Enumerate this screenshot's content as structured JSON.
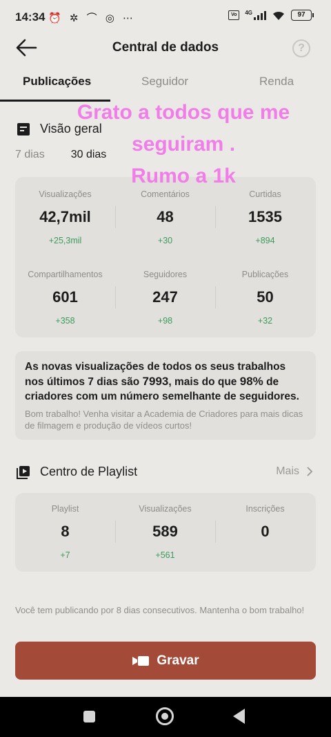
{
  "status_bar": {
    "time": "14:34",
    "left_icons": "⏰ ✲ ⌒ ◎ ⋯",
    "network": "4G",
    "battery": "97"
  },
  "header": {
    "title": "Central de dados",
    "help": "?"
  },
  "tabs": [
    {
      "label": "Publicações",
      "active": true
    },
    {
      "label": "Seguidor",
      "active": false
    },
    {
      "label": "Renda",
      "active": false
    }
  ],
  "overlay_caption": [
    "Grato a todos que me",
    "seguiram .",
    "Rumo a 1k"
  ],
  "overview": {
    "title": "Visão geral",
    "periods": [
      {
        "label": "7 dias",
        "active": false
      },
      {
        "label": "30 dias",
        "active": true
      }
    ],
    "stats": [
      {
        "label": "Visualizações",
        "value": "42,7mil",
        "delta": "+25,3mil"
      },
      {
        "label": "Comentários",
        "value": "48",
        "delta": "+30"
      },
      {
        "label": "Curtidas",
        "value": "1535",
        "delta": "+894"
      },
      {
        "label": "Compartilhamentos",
        "value": "601",
        "delta": "+358"
      },
      {
        "label": "Seguidores",
        "value": "247",
        "delta": "+98"
      },
      {
        "label": "Publicações",
        "value": "50",
        "delta": "+32"
      }
    ]
  },
  "insight": {
    "part1": "As novas visualizações de todos os seus trabalhos nos últimos 7 dias são ",
    "views": "7993",
    "part2": ", mais do que ",
    "percent": "98%",
    "part3": " de criadores com um número semelhante de seguidores.",
    "sub": "Bom trabalho! Venha visitar a Academia de Criadores para mais dicas de filmagem e produção de vídeos curtos!"
  },
  "playlist": {
    "title": "Centro de Playlist",
    "more": "Mais",
    "stats": [
      {
        "label": "Playlist",
        "value": "8",
        "delta": "+7"
      },
      {
        "label": "Visualizações",
        "value": "589",
        "delta": "+561"
      },
      {
        "label": "Inscrições",
        "value": "0",
        "delta": ""
      }
    ]
  },
  "footer_note": "Você tem publicando por 8 dias consecutivos. Mantenha o bom trabalho!",
  "record_button": "Gravar",
  "colors": {
    "background": "#ebe9e5",
    "card": "#e2e0dc",
    "positive": "#3c9a5c",
    "record": "#a44a38",
    "overlay": "#f17de8"
  }
}
